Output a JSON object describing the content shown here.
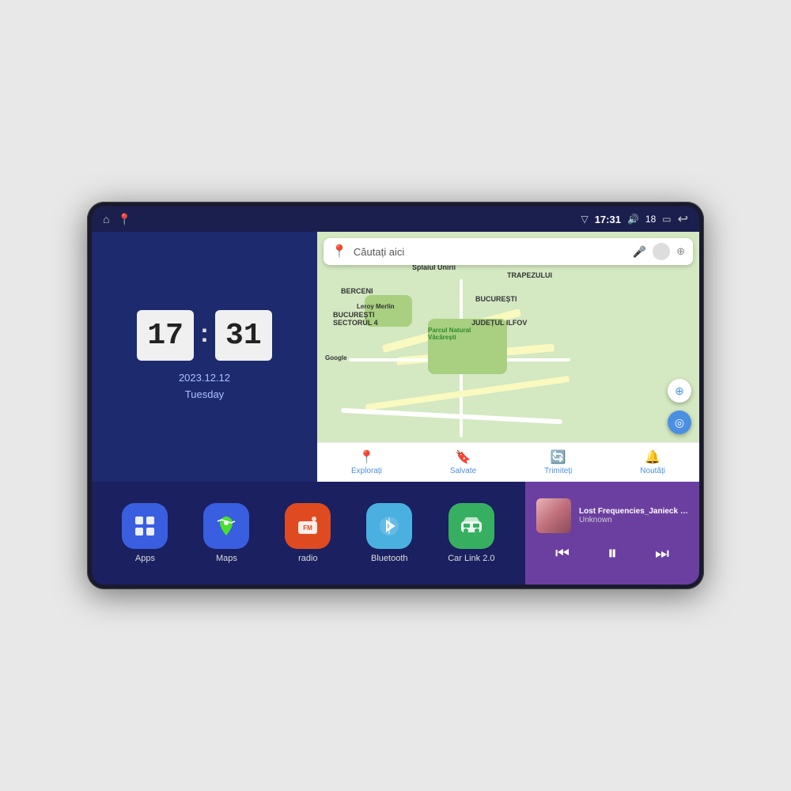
{
  "device": {
    "screen_bg": "#1e2a5e"
  },
  "status_bar": {
    "time": "17:31",
    "signal_icon": "▽",
    "volume_icon": "🔊",
    "battery_level": "18",
    "battery_icon": "🔋",
    "back_icon": "↩",
    "home_icon": "⌂",
    "maps_icon": "📍"
  },
  "clock": {
    "hour": "17",
    "minute": "31",
    "date": "2023.12.12",
    "day": "Tuesday"
  },
  "map": {
    "search_placeholder": "Căutați aici",
    "bottom_nav": [
      {
        "label": "Explorați",
        "icon": "📍",
        "active": true
      },
      {
        "label": "Salvate",
        "icon": "🔖",
        "active": false
      },
      {
        "label": "Trimiteți",
        "icon": "🔄",
        "active": false
      },
      {
        "label": "Noutăți",
        "icon": "🔔",
        "active": false
      }
    ]
  },
  "apps": [
    {
      "label": "Apps",
      "icon": "⊞",
      "bg": "#4a6ee0"
    },
    {
      "label": "Maps",
      "icon": "📍",
      "bg": "#4a6ee0"
    },
    {
      "label": "radio",
      "icon": "📻",
      "bg": "#e04a20"
    },
    {
      "label": "Bluetooth",
      "icon": "📶",
      "bg": "#4ab0e0"
    },
    {
      "label": "Car Link 2.0",
      "icon": "🚗",
      "bg": "#4ae080"
    }
  ],
  "music": {
    "title": "Lost Frequencies_Janieck Devy-...",
    "artist": "Unknown",
    "prev_label": "⏮",
    "play_label": "⏸",
    "next_label": "⏭"
  }
}
